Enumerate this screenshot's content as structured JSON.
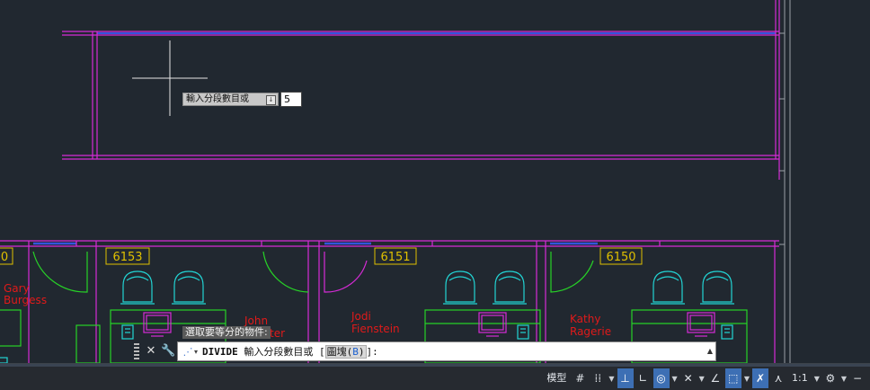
{
  "drawing": {
    "rooms": [
      {
        "number": "6153",
        "occupant": ""
      },
      {
        "number": "6151",
        "occupant": "Jodi\nFienstein"
      },
      {
        "number": "6150",
        "occupant": "Kathy\nRagerie"
      }
    ],
    "partial_room_number": "0",
    "people": {
      "gary_line1": "Gary",
      "gary_line2": "Burgess",
      "john_line1": "John",
      "john_line2": "ter",
      "jodi_line1": "Jodi",
      "jodi_line2": "Fienstein",
      "kathy_line1": "Kathy",
      "kathy_line2": "Ragerie"
    },
    "colors": {
      "background": "#212830",
      "magenta": "#d62bd6",
      "blue": "#3355dd",
      "green": "#27d227",
      "cyan": "#22d4d4",
      "yellow": "#e0c000",
      "red": "#e01a1a",
      "white": "#e6e6e6"
    }
  },
  "dynamic_input": {
    "prompt": "輸入分段數目或",
    "arrow_glyph": "↓",
    "value": "5"
  },
  "command_history": {
    "line": "選取要等分的物件:"
  },
  "command_line": {
    "command": "DIVIDE",
    "prompt": " 輸入分段數目或 [",
    "option_label": "圖塊(",
    "option_key": "B",
    "option_close": ")",
    "suffix": "]:"
  },
  "status_bar": {
    "model_label": "模型",
    "scale_label": "1:1",
    "minus_label": "−",
    "icons": [
      {
        "name": "grid-icon",
        "glyph": "#"
      },
      {
        "name": "snap-icon",
        "glyph": "⁞⁞"
      },
      {
        "name": "infer-constraints-icon",
        "glyph": "⊥"
      },
      {
        "name": "ortho-icon",
        "glyph": "∟"
      },
      {
        "name": "polar-icon",
        "glyph": "◎"
      },
      {
        "name": "isodraft-icon",
        "glyph": "✕"
      },
      {
        "name": "object-snap-tracking-icon",
        "glyph": "∠"
      },
      {
        "name": "object-snap-icon",
        "glyph": "⬚"
      },
      {
        "name": "annotation-visibility-icon",
        "glyph": "✗"
      },
      {
        "name": "auto-scale-icon",
        "glyph": "⋏"
      },
      {
        "name": "gear-icon",
        "glyph": "⚙"
      }
    ]
  }
}
